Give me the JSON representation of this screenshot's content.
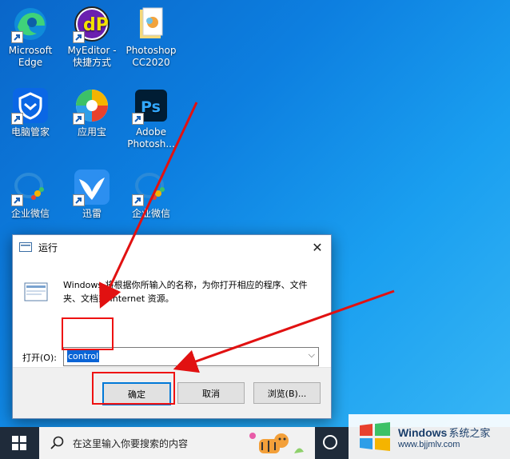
{
  "desktop": {
    "icons": [
      {
        "label": "Microsoft Edge"
      },
      {
        "label": "MyEditor - 快捷方式"
      },
      {
        "label": "Photoshop CC2020"
      },
      {
        "label": "电脑管家"
      },
      {
        "label": "应用宝"
      },
      {
        "label": "Adobe Photosh..."
      },
      {
        "label": "企业微信"
      },
      {
        "label": "迅雷"
      },
      {
        "label": "企业微信"
      }
    ]
  },
  "run_dialog": {
    "title": "运行",
    "close_glyph": "✕",
    "description": "Windows 将根据你所输入的名称，为你打开相应的程序、文件夹、文档或 Internet 资源。",
    "open_label": "打开(O):",
    "open_value": "control",
    "buttons": {
      "ok": "确定",
      "cancel": "取消",
      "browse": "浏览(B)..."
    }
  },
  "taskbar": {
    "search_placeholder": "在这里输入你要搜索的内容"
  },
  "watermark": {
    "brand": "Windows",
    "brand_cn": "系统之家",
    "url": "www.bjjmlv.com"
  },
  "colors": {
    "annotation_red": "#e11111",
    "accent": "#0078d7"
  }
}
